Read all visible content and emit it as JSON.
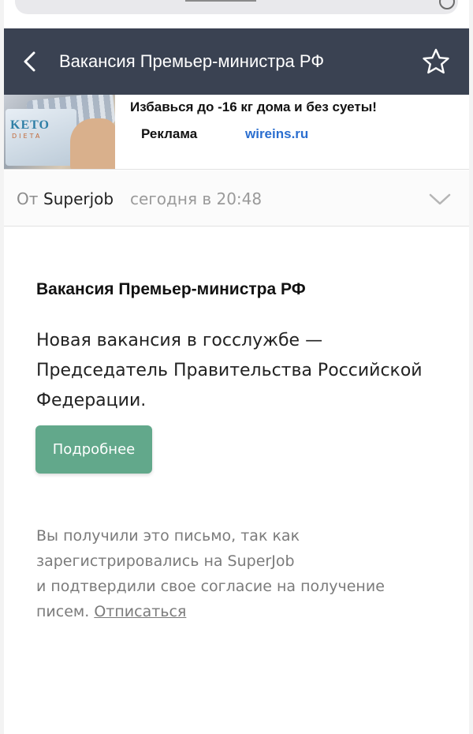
{
  "header": {
    "title": "Вакансия Премьер-министра РФ"
  },
  "ad": {
    "image_brand": "KETO",
    "image_sub": "DIETA",
    "headline": "Избавься до -16 кг дома и без суеты!",
    "label": "Реклама",
    "domain": "wireins.ru"
  },
  "message": {
    "from_prefix": "От",
    "sender": "Superjob",
    "time": "сегодня в 20:48"
  },
  "body": {
    "title": "Вакансия Премьер-министра РФ",
    "text_lines": [
      "Новая вакансия в госслужбе —",
      "Председатель Правительства Российской",
      "Федерации."
    ],
    "button_label": "Подробнее",
    "footer_lines": [
      "Вы получили это письмо, так как",
      "зарегистрировались на SuperJob",
      "и подтвердили свое согласие на получение"
    ],
    "footer_last_prefix": "писем.",
    "unsubscribe_label": "Отписаться"
  },
  "colors": {
    "header_bg": "#3a4252",
    "button_bg": "#62a88b",
    "link": "#2a6ecf"
  },
  "icons": [
    "back-arrow-icon",
    "star-icon",
    "chevron-down-icon"
  ]
}
